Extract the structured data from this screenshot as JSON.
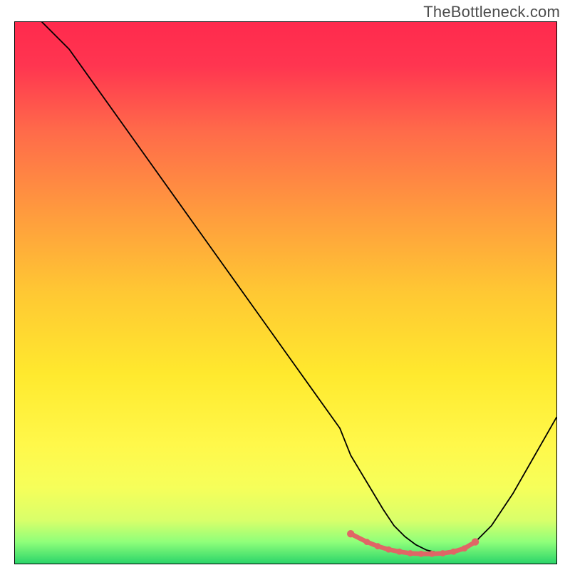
{
  "watermark": "TheBottleneck.com",
  "chart_data": {
    "type": "line",
    "title": "",
    "xlabel": "",
    "ylabel": "",
    "xlim": [
      0,
      100
    ],
    "ylim": [
      0,
      100
    ],
    "series": [
      {
        "name": "curve",
        "x": [
          5,
          10,
          15,
          20,
          25,
          30,
          35,
          40,
          45,
          50,
          55,
          60,
          62,
          65,
          68,
          70,
          72,
          74,
          76,
          78,
          80,
          82,
          85,
          88,
          92,
          96,
          100
        ],
        "y": [
          100,
          95,
          88,
          81,
          74,
          67,
          60,
          53,
          46,
          39,
          32,
          25,
          20,
          15,
          10,
          7,
          5,
          3.5,
          2.5,
          2,
          2,
          2.5,
          4,
          7,
          13,
          20,
          27
        ]
      },
      {
        "name": "highlight-dots",
        "x": [
          62,
          65,
          67,
          69,
          71,
          73,
          75,
          77,
          79,
          81,
          83,
          85
        ],
        "y": [
          5.5,
          4.0,
          3.2,
          2.6,
          2.2,
          1.9,
          1.8,
          1.8,
          1.9,
          2.2,
          2.8,
          4.0
        ]
      }
    ],
    "gradient_stops": [
      {
        "offset": 0.0,
        "color": "#ff2a4d"
      },
      {
        "offset": 0.08,
        "color": "#ff3550"
      },
      {
        "offset": 0.2,
        "color": "#ff6a4a"
      },
      {
        "offset": 0.35,
        "color": "#ff9a3e"
      },
      {
        "offset": 0.5,
        "color": "#ffc833"
      },
      {
        "offset": 0.65,
        "color": "#ffe92e"
      },
      {
        "offset": 0.78,
        "color": "#fff84a"
      },
      {
        "offset": 0.86,
        "color": "#f6ff5a"
      },
      {
        "offset": 0.92,
        "color": "#d9ff6a"
      },
      {
        "offset": 0.96,
        "color": "#8fff7a"
      },
      {
        "offset": 1.0,
        "color": "#2bd56a"
      }
    ]
  }
}
